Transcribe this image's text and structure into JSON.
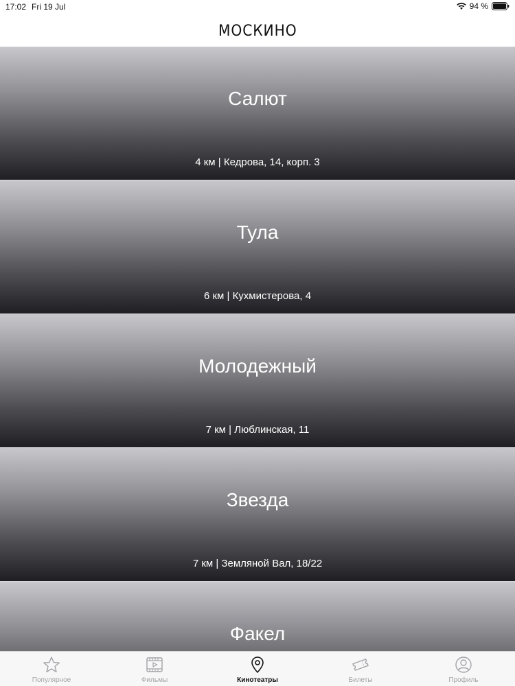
{
  "status_bar": {
    "time": "17:02",
    "date": "Fri 19 Jul",
    "battery": "94 %",
    "wifi_icon": "wifi-icon",
    "battery_icon": "battery-icon"
  },
  "header": {
    "title": "МОСКИНО"
  },
  "cinemas": [
    {
      "name": "Салют",
      "info": "4 км | Кедрова, 14, корп. 3"
    },
    {
      "name": "Тула",
      "info": "6 км | Кухмистерова, 4"
    },
    {
      "name": "Молодежный",
      "info": "7 км | Люблинская, 11"
    },
    {
      "name": "Звезда",
      "info": "7 км | Земляной Вал, 18/22"
    },
    {
      "name": "Факел",
      "info": ""
    }
  ],
  "tabs": [
    {
      "label": "Популярное",
      "icon": "star-icon",
      "active": false
    },
    {
      "label": "Фильмы",
      "icon": "film-icon",
      "active": false
    },
    {
      "label": "Кинотеатры",
      "icon": "location-pin-icon",
      "active": true
    },
    {
      "label": "Билеты",
      "icon": "ticket-icon",
      "active": false
    },
    {
      "label": "Профиль",
      "icon": "profile-icon",
      "active": false
    }
  ],
  "colors": {
    "active_tab": "#111111",
    "inactive_tab": "#a3a3a6",
    "card_top": "#c8c7cc",
    "card_bottom": "#1f1e22"
  }
}
